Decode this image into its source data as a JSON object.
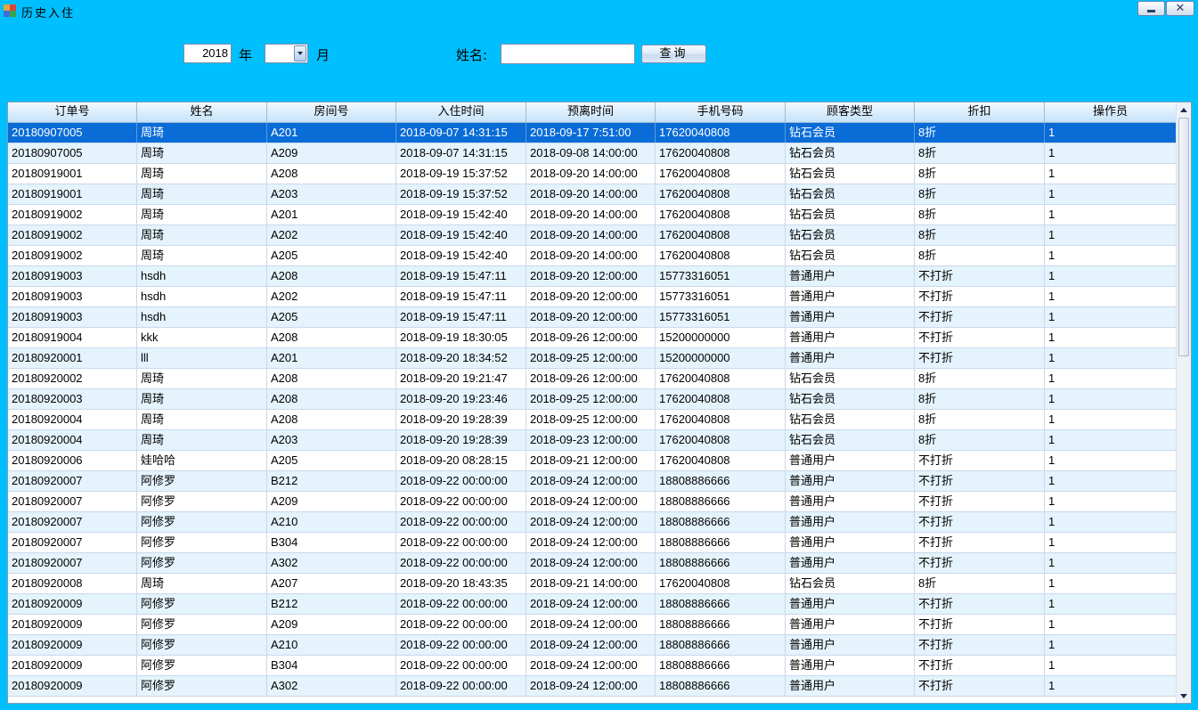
{
  "window": {
    "title": "历史入住",
    "icon": "app-window-icon",
    "controls": {
      "minimize_icon": "minimize-icon",
      "close_icon": "close-icon",
      "close_glyph": "✕"
    }
  },
  "query": {
    "year_value": "2018",
    "year_label": "年",
    "month_value": "",
    "month_label": "月",
    "name_label": "姓名:",
    "name_value": "",
    "query_button": "查询"
  },
  "colors": {
    "window_bg": "#00bfff",
    "selected_row": "#0a6cd6",
    "alt_row": "#e4f3fc"
  },
  "table": {
    "columns": [
      "订单号",
      "姓名",
      "房间号",
      "入住时间",
      "预离时间",
      "手机号码",
      "顾客类型",
      "折扣",
      "操作员"
    ],
    "selected_index": 0,
    "rows": [
      [
        "20180907005",
        "周琦",
        "A201",
        "2018-09-07 14:31:15",
        "2018-09-17 7:51:00",
        "17620040808",
        "钻石会员",
        "8折",
        "1"
      ],
      [
        "20180907005",
        "周琦",
        "A209",
        "2018-09-07 14:31:15",
        "2018-09-08 14:00:00",
        "17620040808",
        "钻石会员",
        "8折",
        "1"
      ],
      [
        "20180919001",
        "周琦",
        "A208",
        "2018-09-19 15:37:52",
        "2018-09-20 14:00:00",
        "17620040808",
        "钻石会员",
        "8折",
        "1"
      ],
      [
        "20180919001",
        "周琦",
        "A203",
        "2018-09-19 15:37:52",
        "2018-09-20 14:00:00",
        "17620040808",
        "钻石会员",
        "8折",
        "1"
      ],
      [
        "20180919002",
        "周琦",
        "A201",
        "2018-09-19 15:42:40",
        "2018-09-20 14:00:00",
        "17620040808",
        "钻石会员",
        "8折",
        "1"
      ],
      [
        "20180919002",
        "周琦",
        "A202",
        "2018-09-19 15:42:40",
        "2018-09-20 14:00:00",
        "17620040808",
        "钻石会员",
        "8折",
        "1"
      ],
      [
        "20180919002",
        "周琦",
        "A205",
        "2018-09-19 15:42:40",
        "2018-09-20 14:00:00",
        "17620040808",
        "钻石会员",
        "8折",
        "1"
      ],
      [
        "20180919003",
        "hsdh",
        "A208",
        "2018-09-19 15:47:11",
        "2018-09-20 12:00:00",
        "15773316051",
        "普通用户",
        "不打折",
        "1"
      ],
      [
        "20180919003",
        "hsdh",
        "A202",
        "2018-09-19 15:47:11",
        "2018-09-20 12:00:00",
        "15773316051",
        "普通用户",
        "不打折",
        "1"
      ],
      [
        "20180919003",
        "hsdh",
        "A205",
        "2018-09-19 15:47:11",
        "2018-09-20 12:00:00",
        "15773316051",
        "普通用户",
        "不打折",
        "1"
      ],
      [
        "20180919004",
        "kkk",
        "A208",
        "2018-09-19 18:30:05",
        "2018-09-26 12:00:00",
        "15200000000",
        "普通用户",
        "不打折",
        "1"
      ],
      [
        "20180920001",
        "lll",
        "A201",
        "2018-09-20 18:34:52",
        "2018-09-25 12:00:00",
        "15200000000",
        "普通用户",
        "不打折",
        "1"
      ],
      [
        "20180920002",
        "周琦",
        "A208",
        "2018-09-20 19:21:47",
        "2018-09-26 12:00:00",
        "17620040808",
        "钻石会员",
        "8折",
        "1"
      ],
      [
        "20180920003",
        "周琦",
        "A208",
        "2018-09-20 19:23:46",
        "2018-09-25 12:00:00",
        "17620040808",
        "钻石会员",
        "8折",
        "1"
      ],
      [
        "20180920004",
        "周琦",
        "A208",
        "2018-09-20 19:28:39",
        "2018-09-25 12:00:00",
        "17620040808",
        "钻石会员",
        "8折",
        "1"
      ],
      [
        "20180920004",
        "周琦",
        "A203",
        "2018-09-20 19:28:39",
        "2018-09-23 12:00:00",
        "17620040808",
        "钻石会员",
        "8折",
        "1"
      ],
      [
        "20180920006",
        "娃哈哈",
        "A205",
        "2018-09-20 08:28:15",
        "2018-09-21 12:00:00",
        "17620040808",
        "普通用户",
        "不打折",
        "1"
      ],
      [
        "20180920007",
        "阿修罗",
        "B212",
        "2018-09-22 00:00:00",
        "2018-09-24 12:00:00",
        "18808886666",
        "普通用户",
        "不打折",
        "1"
      ],
      [
        "20180920007",
        "阿修罗",
        "A209",
        "2018-09-22 00:00:00",
        "2018-09-24 12:00:00",
        "18808886666",
        "普通用户",
        "不打折",
        "1"
      ],
      [
        "20180920007",
        "阿修罗",
        "A210",
        "2018-09-22 00:00:00",
        "2018-09-24 12:00:00",
        "18808886666",
        "普通用户",
        "不打折",
        "1"
      ],
      [
        "20180920007",
        "阿修罗",
        "B304",
        "2018-09-22 00:00:00",
        "2018-09-24 12:00:00",
        "18808886666",
        "普通用户",
        "不打折",
        "1"
      ],
      [
        "20180920007",
        "阿修罗",
        "A302",
        "2018-09-22 00:00:00",
        "2018-09-24 12:00:00",
        "18808886666",
        "普通用户",
        "不打折",
        "1"
      ],
      [
        "20180920008",
        "周琦",
        "A207",
        "2018-09-20 18:43:35",
        "2018-09-21 14:00:00",
        "17620040808",
        "钻石会员",
        "8折",
        "1"
      ],
      [
        "20180920009",
        "阿修罗",
        "B212",
        "2018-09-22 00:00:00",
        "2018-09-24 12:00:00",
        "18808886666",
        "普通用户",
        "不打折",
        "1"
      ],
      [
        "20180920009",
        "阿修罗",
        "A209",
        "2018-09-22 00:00:00",
        "2018-09-24 12:00:00",
        "18808886666",
        "普通用户",
        "不打折",
        "1"
      ],
      [
        "20180920009",
        "阿修罗",
        "A210",
        "2018-09-22 00:00:00",
        "2018-09-24 12:00:00",
        "18808886666",
        "普通用户",
        "不打折",
        "1"
      ],
      [
        "20180920009",
        "阿修罗",
        "B304",
        "2018-09-22 00:00:00",
        "2018-09-24 12:00:00",
        "18808886666",
        "普通用户",
        "不打折",
        "1"
      ],
      [
        "20180920009",
        "阿修罗",
        "A302",
        "2018-09-22 00:00:00",
        "2018-09-24 12:00:00",
        "18808886666",
        "普通用户",
        "不打折",
        "1"
      ]
    ]
  },
  "scrollbar": {
    "up_icon": "scroll-up-icon",
    "down_icon": "scroll-down-icon"
  }
}
